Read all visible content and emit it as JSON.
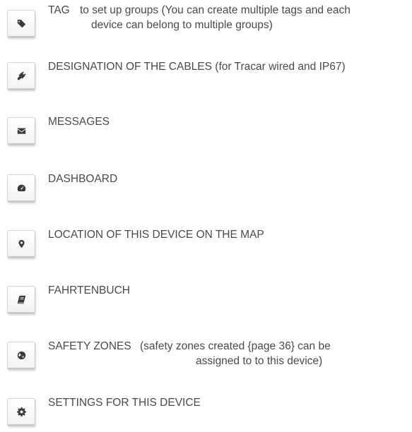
{
  "items": [
    {
      "icon": "tag-icon",
      "label": "TAG",
      "desc_line1": "to set up groups (You can create multiple tags and each",
      "desc_line2": "device can belong to multiple groups)"
    },
    {
      "icon": "plug-icon",
      "label": "DESIGNATION OF THE CABLES (for Tracar wired and IP67)"
    },
    {
      "icon": "envelope-icon",
      "label": "MESSAGES"
    },
    {
      "icon": "dashboard-icon",
      "label": "DASHBOARD"
    },
    {
      "icon": "map-marker-icon",
      "label": "LOCATION OF THIS DEVICE ON THE MAP"
    },
    {
      "icon": "book-icon",
      "label": "FAHRTENBUCH"
    },
    {
      "icon": "globe-icon",
      "label": "SAFETY ZONES",
      "desc_line1": "(safety zones created {page 36} can be",
      "desc_line2": "assigned to to this device)"
    },
    {
      "icon": "gear-icon",
      "label": "SETTINGS FOR THIS DEVICE"
    }
  ]
}
